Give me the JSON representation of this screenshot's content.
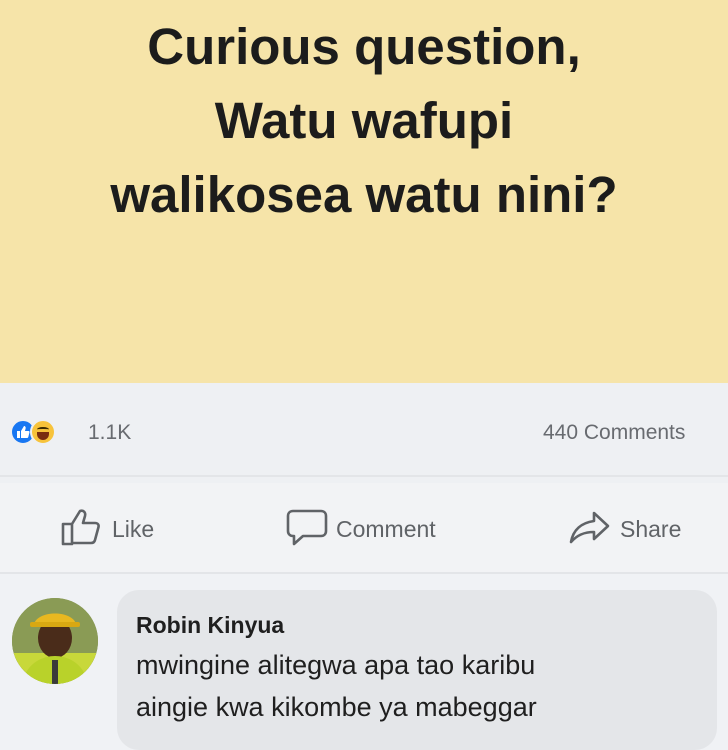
{
  "post": {
    "lines": [
      "Curious question,",
      "Watu wafupi",
      "walikosea watu nini?"
    ],
    "background": "#f6e4a9"
  },
  "stats": {
    "reaction_count": "1.1K",
    "comment_count": "440 Comments",
    "reactions": [
      "like-icon",
      "haha-icon"
    ]
  },
  "actions": {
    "like_label": "Like",
    "comment_label": "Comment",
    "share_label": "Share"
  },
  "comment": {
    "author": "Robin Kinyua",
    "lines": [
      "mwingine alitegwa apa tao karibu",
      "aingie kwa kikombe ya mabeggar"
    ]
  },
  "colors": {
    "accent": "#1877f2",
    "haha": "#f7c33b"
  }
}
